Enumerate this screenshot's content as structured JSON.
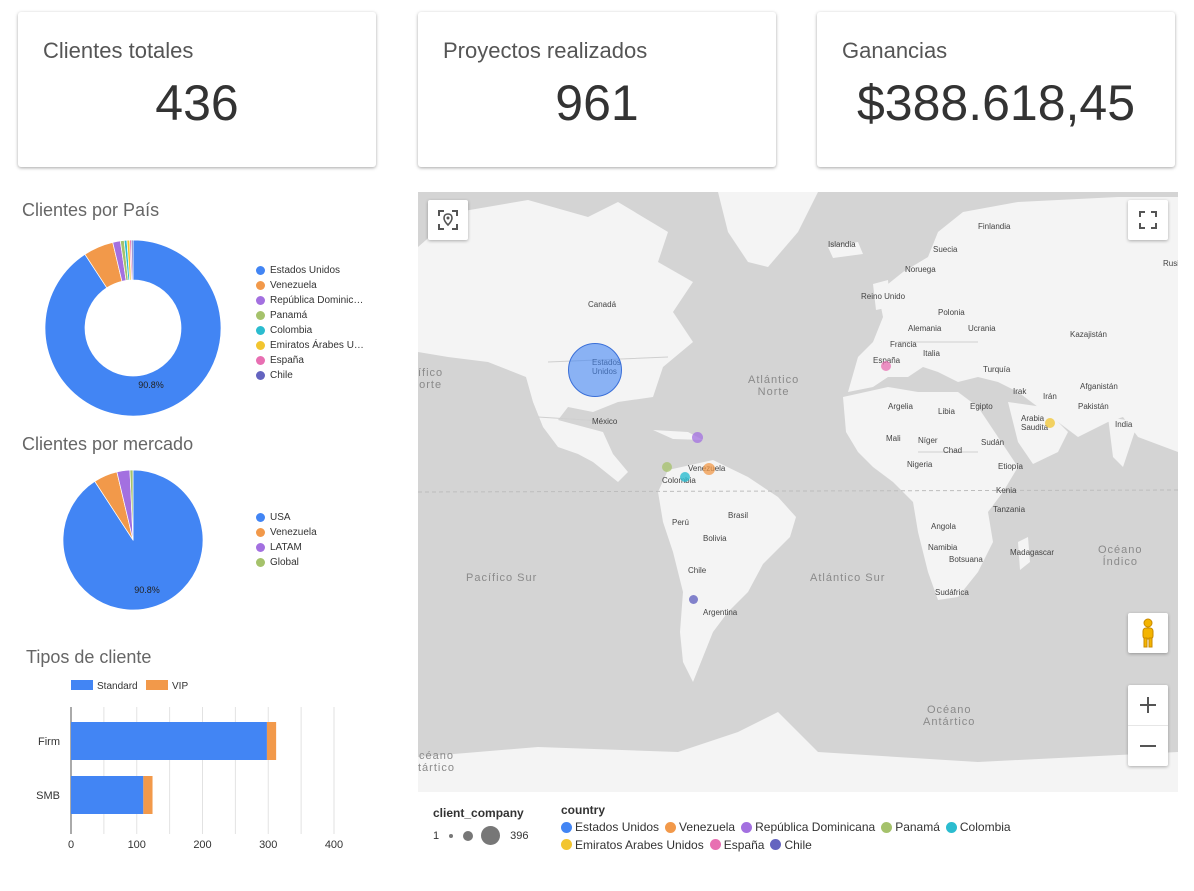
{
  "kpis": {
    "clients": {
      "label": "Clientes totales",
      "value": "436"
    },
    "projects": {
      "label": "Proyectos realizados",
      "value": "961"
    },
    "earnings": {
      "label": "Ganancias",
      "value": "$388.618,45"
    }
  },
  "colors": {
    "blue": "#4285f4",
    "orange": "#f2994a",
    "purple": "#a370e0",
    "green": "#a5c26b",
    "teal": "#2bbccf",
    "yellow": "#f2c530",
    "pink": "#e86fb2",
    "navy": "#6464c0"
  },
  "country_chart": {
    "title": "Clientes por País",
    "legend": [
      "Estados Unidos",
      "Venezuela",
      "República Dominic…",
      "Panamá",
      "Colombia",
      "Emiratos Árabes U…",
      "España",
      "Chile"
    ],
    "slice_label": "90.8%"
  },
  "market_chart": {
    "title": "Clientes por mercado",
    "legend": [
      "USA",
      "Venezuela",
      "LATAM",
      "Global"
    ],
    "slice_label": "90.8%"
  },
  "type_chart": {
    "title": "Tipos de cliente",
    "legend": [
      "Standard",
      "VIP"
    ],
    "categories": [
      "Firm",
      "SMB"
    ],
    "ticks": [
      "0",
      "100",
      "200",
      "300",
      "400"
    ]
  },
  "map": {
    "labels": [
      "Islandia",
      "Finlandia",
      "Suecia",
      "Noruega",
      "Rusia",
      "Canadá",
      "Reino Unido",
      "Polonia",
      "Alemania",
      "Ucrania",
      "Kazajistán",
      "Francia",
      "Italia",
      "España",
      "Turquía",
      "Irak",
      "Irán",
      "Afganistán",
      "Pakistán",
      "Argelia",
      "Libia",
      "Egipto",
      "Arabia Saudita",
      "India",
      "Mali",
      "Níger",
      "Chad",
      "Sudán",
      "Nigeria",
      "Etiopía",
      "Kenia",
      "Tanzania",
      "Angola",
      "Namibia",
      "Botsuana",
      "Madagascar",
      "Sudáfrica",
      "México",
      "Estados Unidos",
      "Venezuela",
      "Colombia",
      "Perú",
      "Brasil",
      "Bolivia",
      "Chile",
      "Argentina"
    ],
    "oceans": {
      "pac_n": "ífico\norte",
      "atl_n": "Atlántico\nNorte",
      "pac_s": "Pacífico Sur",
      "atl_s": "Atlántico Sur",
      "ind": "Océano\nÍndico",
      "ant": "Océano\nAntártico",
      "ant_left": "céano\ntártico"
    },
    "legend_size_title": "client_company",
    "legend_size_min": "1",
    "legend_size_max": "396",
    "legend_color_title": "country",
    "countries": [
      "Estados Unidos",
      "Venezuela",
      "República Dominicana",
      "Panamá",
      "Colombia",
      "Emiratos Arabes Unidos",
      "España",
      "Chile"
    ]
  },
  "chart_data": [
    {
      "type": "pie",
      "title": "Clientes por País",
      "donut": true,
      "categories": [
        "Estados Unidos",
        "Venezuela",
        "República Dominicana",
        "Panamá",
        "Colombia",
        "Emiratos Árabes Unidos",
        "España",
        "Chile"
      ],
      "values": [
        90.8,
        5.5,
        1.4,
        0.7,
        0.5,
        0.5,
        0.3,
        0.3
      ],
      "data_labels": [
        "90.8%"
      ]
    },
    {
      "type": "pie",
      "title": "Clientes por mercado",
      "donut": false,
      "categories": [
        "USA",
        "Venezuela",
        "LATAM",
        "Global"
      ],
      "values": [
        90.8,
        5.5,
        3.0,
        0.7
      ],
      "data_labels": [
        "90.8%"
      ]
    },
    {
      "type": "bar",
      "orientation": "horizontal",
      "stacked": true,
      "title": "Tipos de cliente",
      "categories": [
        "Firm",
        "SMB"
      ],
      "series": [
        {
          "name": "Standard",
          "values": [
            298,
            110
          ]
        },
        {
          "name": "VIP",
          "values": [
            14,
            14
          ]
        }
      ],
      "xlim": [
        0,
        400
      ],
      "xticks": [
        0,
        100,
        200,
        300,
        400
      ],
      "grid": true,
      "legend": "top"
    }
  ]
}
